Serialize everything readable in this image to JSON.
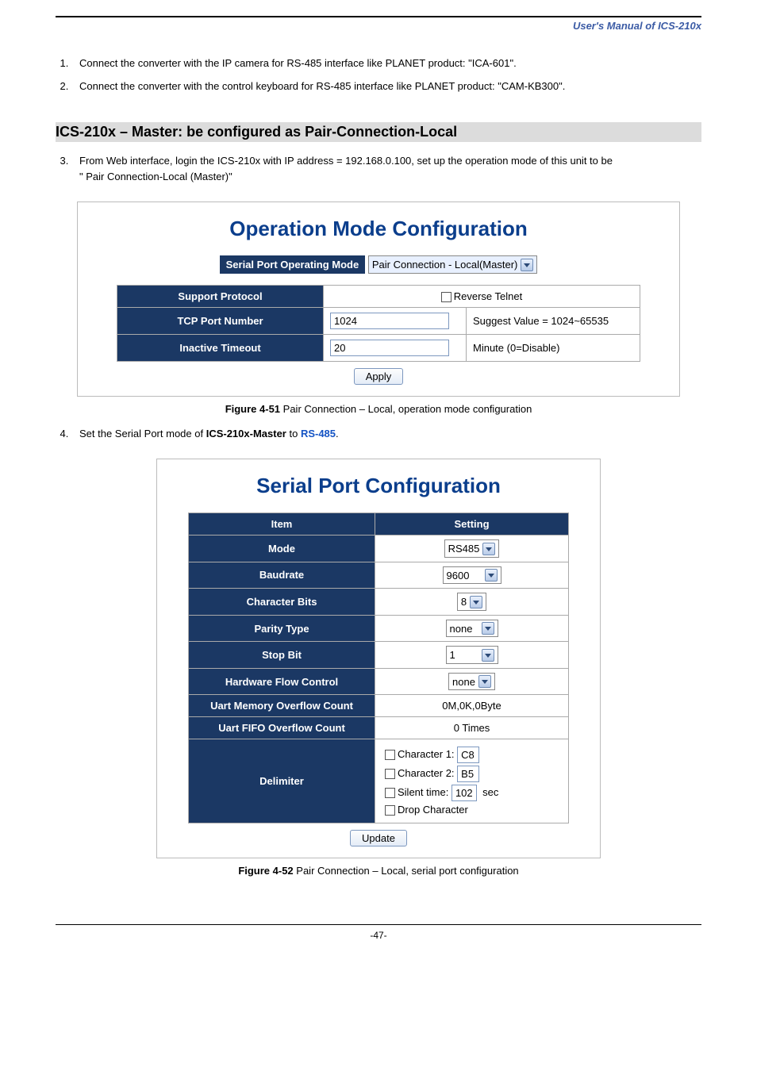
{
  "header": {
    "manual_title": "User's Manual of ICS-210x"
  },
  "list": {
    "li1": "Connect the converter with the IP camera for RS-485 interface like PLANET product: \"ICA-601\".",
    "li2": "Connect the converter with the control keyboard for RS-485 interface like PLANET product: \"CAM-KB300\".",
    "li3a": "From Web interface, login the ICS-210x with IP address = 192.168.0.100, set up the operation mode of this unit to be",
    "li3b": "\" Pair Connection-Local (Master)\"",
    "li4a": "Set the Serial Port mode of ",
    "li4b": "ICS-210x-Master",
    "li4c": " to ",
    "li4d": "RS-485",
    "li4e": "."
  },
  "section_heading": "ICS-210x – Master: be configured as Pair-Connection-Local",
  "opmode": {
    "title": "Operation Mode Configuration",
    "op_label": "Serial Port Operating Mode",
    "op_value": "Pair Connection - Local(Master)",
    "support_protocol_label": "Support Protocol",
    "reverse_telnet_label": "Reverse Telnet",
    "tcp_port_label": "TCP Port Number",
    "tcp_port_value": "1024",
    "tcp_port_hint": "Suggest Value = 1024~65535",
    "timeout_label": "Inactive Timeout",
    "timeout_value": "20",
    "timeout_hint": "Minute (0=Disable)",
    "apply": "Apply"
  },
  "caption1": {
    "b": "Figure 4-51",
    "rest": " Pair Connection – Local, operation mode configuration"
  },
  "serial": {
    "title": "Serial Port Configuration",
    "th_item": "Item",
    "th_setting": "Setting",
    "mode_label": "Mode",
    "mode_value": "RS485",
    "baud_label": "Baudrate",
    "baud_value": "9600",
    "char_label": "Character Bits",
    "char_value": "8",
    "parity_label": "Parity Type",
    "parity_value": "none",
    "stop_label": "Stop Bit",
    "stop_value": "1",
    "flow_label": "Hardware Flow Control",
    "flow_value": "none",
    "memover_label": "Uart Memory Overflow Count",
    "memover_value": "0M,0K,0Byte",
    "fifoover_label": "Uart FIFO Overflow Count",
    "fifoover_value": "0 Times",
    "delim_label": "Delimiter",
    "delim_c1_label": "Character 1:",
    "delim_c1_value": "C8",
    "delim_c2_label": "Character 2:",
    "delim_c2_value": "B5",
    "delim_silent_label": "Silent time:",
    "delim_silent_value": "102",
    "delim_silent_unit": "sec",
    "delim_drop_label": "Drop Character",
    "update": "Update"
  },
  "caption2": {
    "b": "Figure 4-52",
    "rest": " Pair Connection – Local, serial port configuration"
  },
  "footer": {
    "page": "-47-"
  }
}
